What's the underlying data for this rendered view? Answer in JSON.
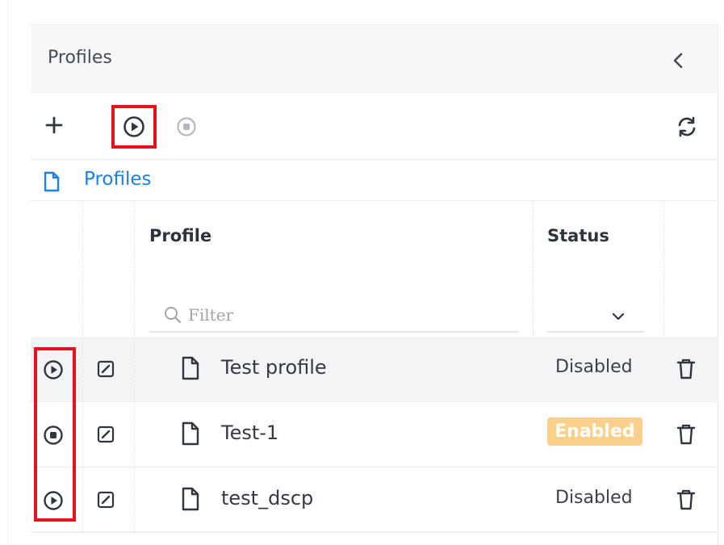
{
  "panel": {
    "title": "Profiles"
  },
  "toolbar": {
    "add_icon": "plus-icon",
    "run_icon": "play-circle-icon",
    "stop_icon": "stop-circle-icon",
    "refresh_icon": "refresh-icon"
  },
  "breadcrumb": {
    "label": "Profiles"
  },
  "table": {
    "columns": {
      "profile": "Profile",
      "status": "Status"
    },
    "filter_placeholder": "Filter",
    "status_select_value": "",
    "rows": [
      {
        "name": "Test profile",
        "status": "Disabled",
        "run_state": "play",
        "selected": true
      },
      {
        "name": "Test-1",
        "status": "Enabled",
        "run_state": "stop",
        "selected": false
      },
      {
        "name": "test_dscp",
        "status": "Disabled",
        "run_state": "play",
        "selected": false
      }
    ]
  },
  "colors": {
    "accent_blue": "#1f7fe0",
    "highlight_red": "#e8101a",
    "enabled_badge": "#fbd08a"
  }
}
